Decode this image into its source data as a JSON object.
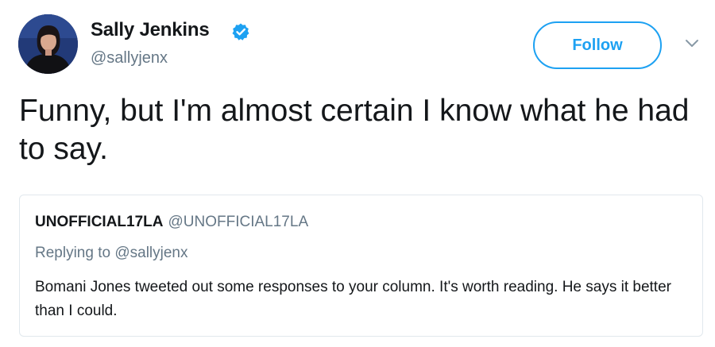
{
  "author": {
    "display_name": "Sally Jenkins",
    "handle": "@sallyjenx",
    "verified_color": "#1da1f2"
  },
  "actions": {
    "follow_label": "Follow",
    "more_icon": "chevron-down-icon"
  },
  "tweet": {
    "text": "Funny, but I'm almost certain I know what he had to say."
  },
  "quoted_tweet": {
    "display_name": "UNOFFICIAL17LA",
    "handle": "@UNOFFICIAL17LA",
    "replying_to": "Replying to @sallyjenx",
    "text": "Bomani Jones tweeted out some responses to your column. It's worth reading.  He says it better than I could."
  },
  "colors": {
    "accent": "#1da1f2",
    "text": "#14171a",
    "secondary_text": "#657786",
    "card_border": "#e1e8ed"
  }
}
